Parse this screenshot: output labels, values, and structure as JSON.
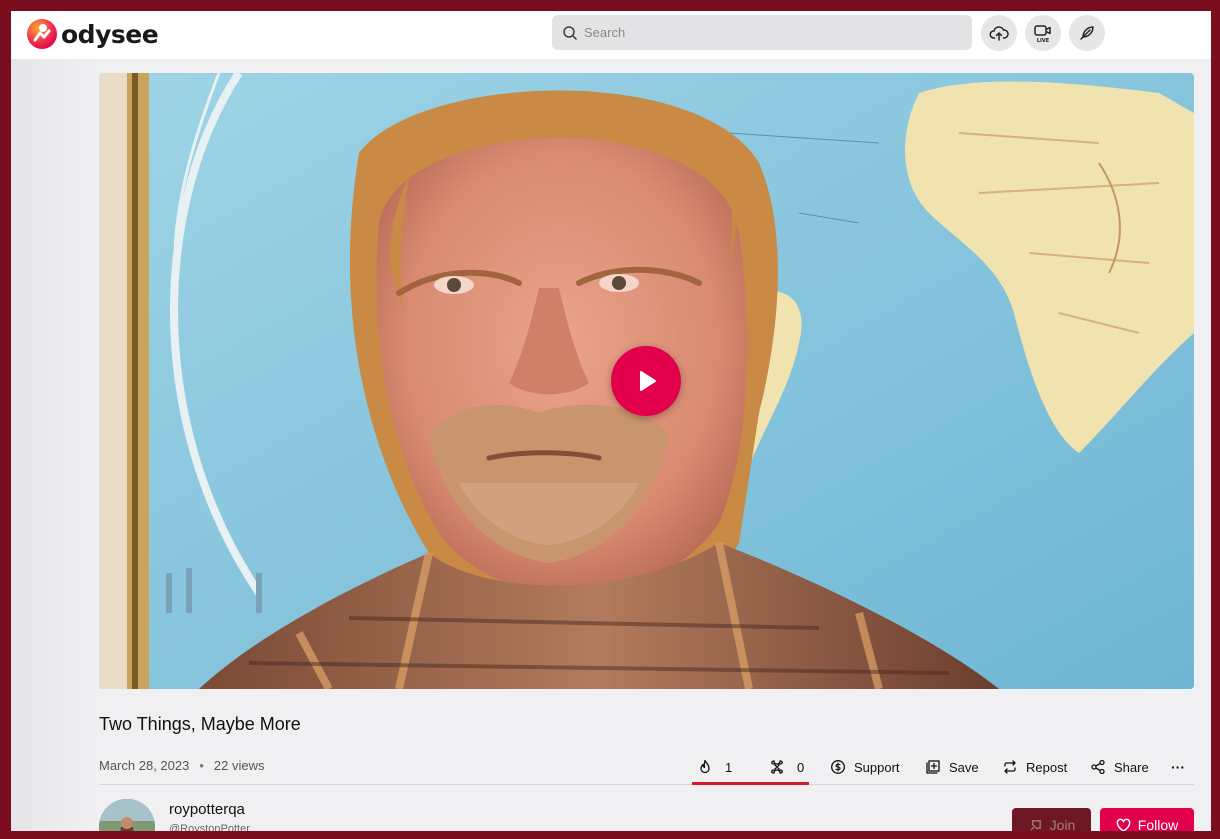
{
  "brand": {
    "name": "odysee",
    "accent": "#e2004c"
  },
  "header": {
    "search_placeholder": "Search",
    "buttons": [
      {
        "icon": "upload-cloud-icon"
      },
      {
        "icon": "go-live-icon",
        "label": "LIVE"
      },
      {
        "icon": "publish-feather-icon"
      }
    ]
  },
  "video": {
    "thumbnail": "man-in-front-of-world-map",
    "play_icon": "play-icon"
  },
  "content": {
    "title": "Two Things, Maybe More",
    "date": "March 28, 2023",
    "views": "22 views"
  },
  "actions": {
    "fire_count": "1",
    "slime_count": "0",
    "support": "Support",
    "save": "Save",
    "repost": "Repost",
    "share": "Share",
    "more": "···"
  },
  "channel": {
    "name": "roypotterqa",
    "handle": "@RoystonPotter",
    "join": "Join",
    "follow": "Follow"
  }
}
